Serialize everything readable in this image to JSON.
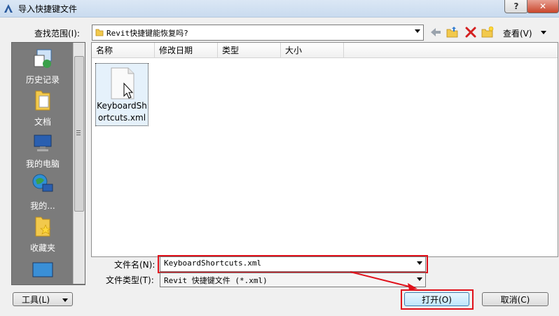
{
  "window": {
    "title": "导入快捷键文件",
    "help_label": "?",
    "close_label": "✕"
  },
  "toolbar": {
    "look_in_label": "查找范围(I):",
    "look_in_value": "Revit快捷键能恢复吗?",
    "view_label": "查看(V)",
    "icons": [
      "back-arrow-icon",
      "up-folder-icon",
      "delete-icon",
      "new-folder-icon"
    ]
  },
  "places": [
    {
      "label": "历史记录",
      "icon": "history-icon"
    },
    {
      "label": "文档",
      "icon": "documents-icon"
    },
    {
      "label": "我的电脑",
      "icon": "computer-icon"
    },
    {
      "label": "我的...",
      "icon": "network-icon"
    },
    {
      "label": "收藏夹",
      "icon": "favorites-icon"
    }
  ],
  "columns": [
    "名称",
    "修改日期",
    "类型",
    "大小"
  ],
  "files": [
    {
      "name": "KeyboardShortcuts.xml"
    }
  ],
  "file_name": {
    "label": "文件名(N):",
    "value": "KeyboardShortcuts.xml"
  },
  "file_type": {
    "label": "文件类型(T):",
    "value": "Revit  快捷键文件  (*.xml)"
  },
  "buttons": {
    "tools": "工具(L)",
    "open": "打开(O)",
    "cancel": "取消(C)"
  },
  "colors": {
    "highlight": "#e0101a",
    "places_bg": "#7b7b7b",
    "titlebar": "#dbe7f5"
  }
}
